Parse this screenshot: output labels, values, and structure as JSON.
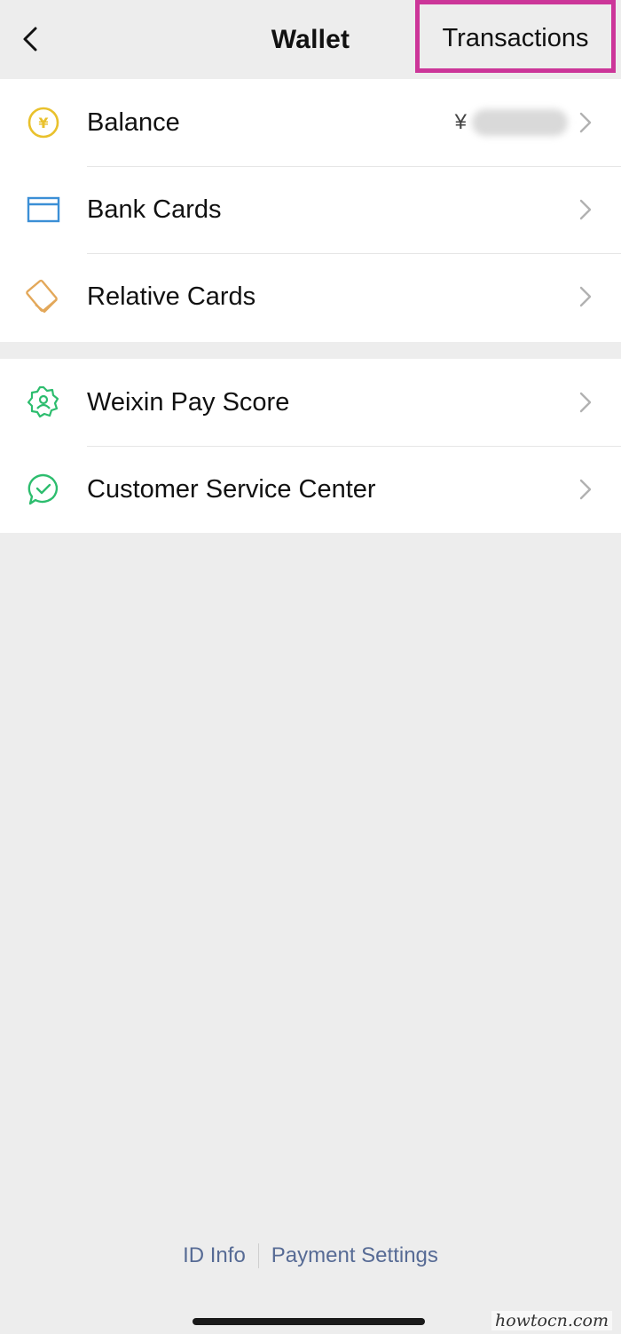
{
  "header": {
    "title": "Wallet",
    "transactions_label": "Transactions"
  },
  "groups": [
    {
      "rows": [
        {
          "label": "Balance",
          "value_prefix": "¥",
          "icon": "yuan-coin-icon"
        },
        {
          "label": "Bank Cards",
          "icon": "bank-card-icon"
        },
        {
          "label": "Relative Cards",
          "icon": "relative-cards-icon"
        }
      ]
    },
    {
      "rows": [
        {
          "label": "Weixin Pay Score",
          "icon": "pay-score-badge-icon"
        },
        {
          "label": "Customer Service Center",
          "icon": "chat-bubble-icon"
        }
      ]
    }
  ],
  "footer": {
    "id_info": "ID Info",
    "payment_settings": "Payment Settings"
  },
  "watermark": "howtocn.com",
  "colors": {
    "highlight_border": "#cc3699",
    "link": "#576b95",
    "yuan_icon": "#e9c12c",
    "bank_card_icon": "#3b8fd6",
    "relative_cards_icon": "#e3a85a",
    "green_icons": "#2dbd6e"
  }
}
